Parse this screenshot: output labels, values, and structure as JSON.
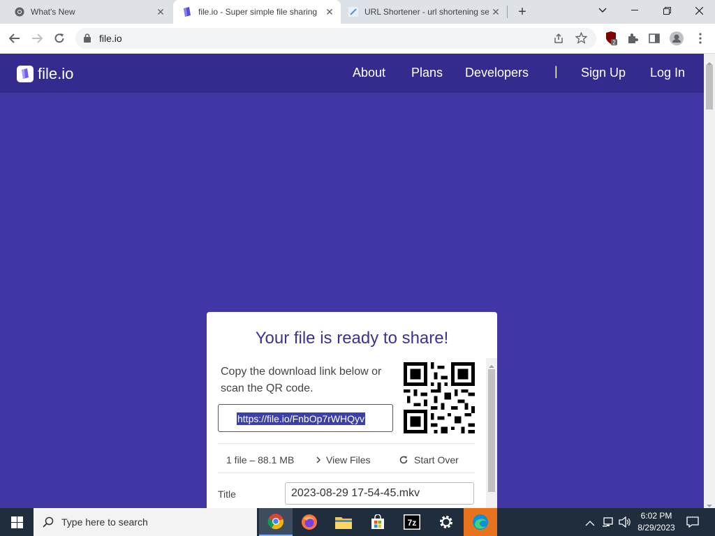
{
  "browser": {
    "tabs": [
      {
        "title": "What's New",
        "active": false
      },
      {
        "title": "file.io - Super simple file sharing",
        "active": true
      },
      {
        "title": "URL Shortener - url shortening se",
        "active": false
      }
    ],
    "new_tab_label": "+",
    "address": "file.io"
  },
  "site": {
    "brand": "file.io",
    "nav": {
      "about": "About",
      "plans": "Plans",
      "developers": "Developers",
      "separator": "|",
      "sign_up": "Sign Up",
      "log_in": "Log In"
    },
    "colors": {
      "nav_bg": "#342b8f",
      "page_bg": "#4137a4",
      "title": "#3b3392"
    }
  },
  "card": {
    "heading": "Your file is ready to share!",
    "instructions": "Copy the download link below or scan the QR code.",
    "link": "https://file.io/FnbOp7rWHQyv",
    "file_summary": "1 file – 88.1 MB",
    "view_files": "View Files",
    "start_over": "Start Over",
    "title_label": "Title",
    "title_value": "2023-08-29 17-54-45.mkv"
  },
  "taskbar": {
    "search_placeholder": "Type here to search",
    "time": "6:02 PM",
    "date": "8/29/2023",
    "apps": [
      "chrome-icon",
      "firefox-icon",
      "file-explorer-icon",
      "store-icon",
      "7zip-icon",
      "settings-icon",
      "edge-icon"
    ]
  }
}
